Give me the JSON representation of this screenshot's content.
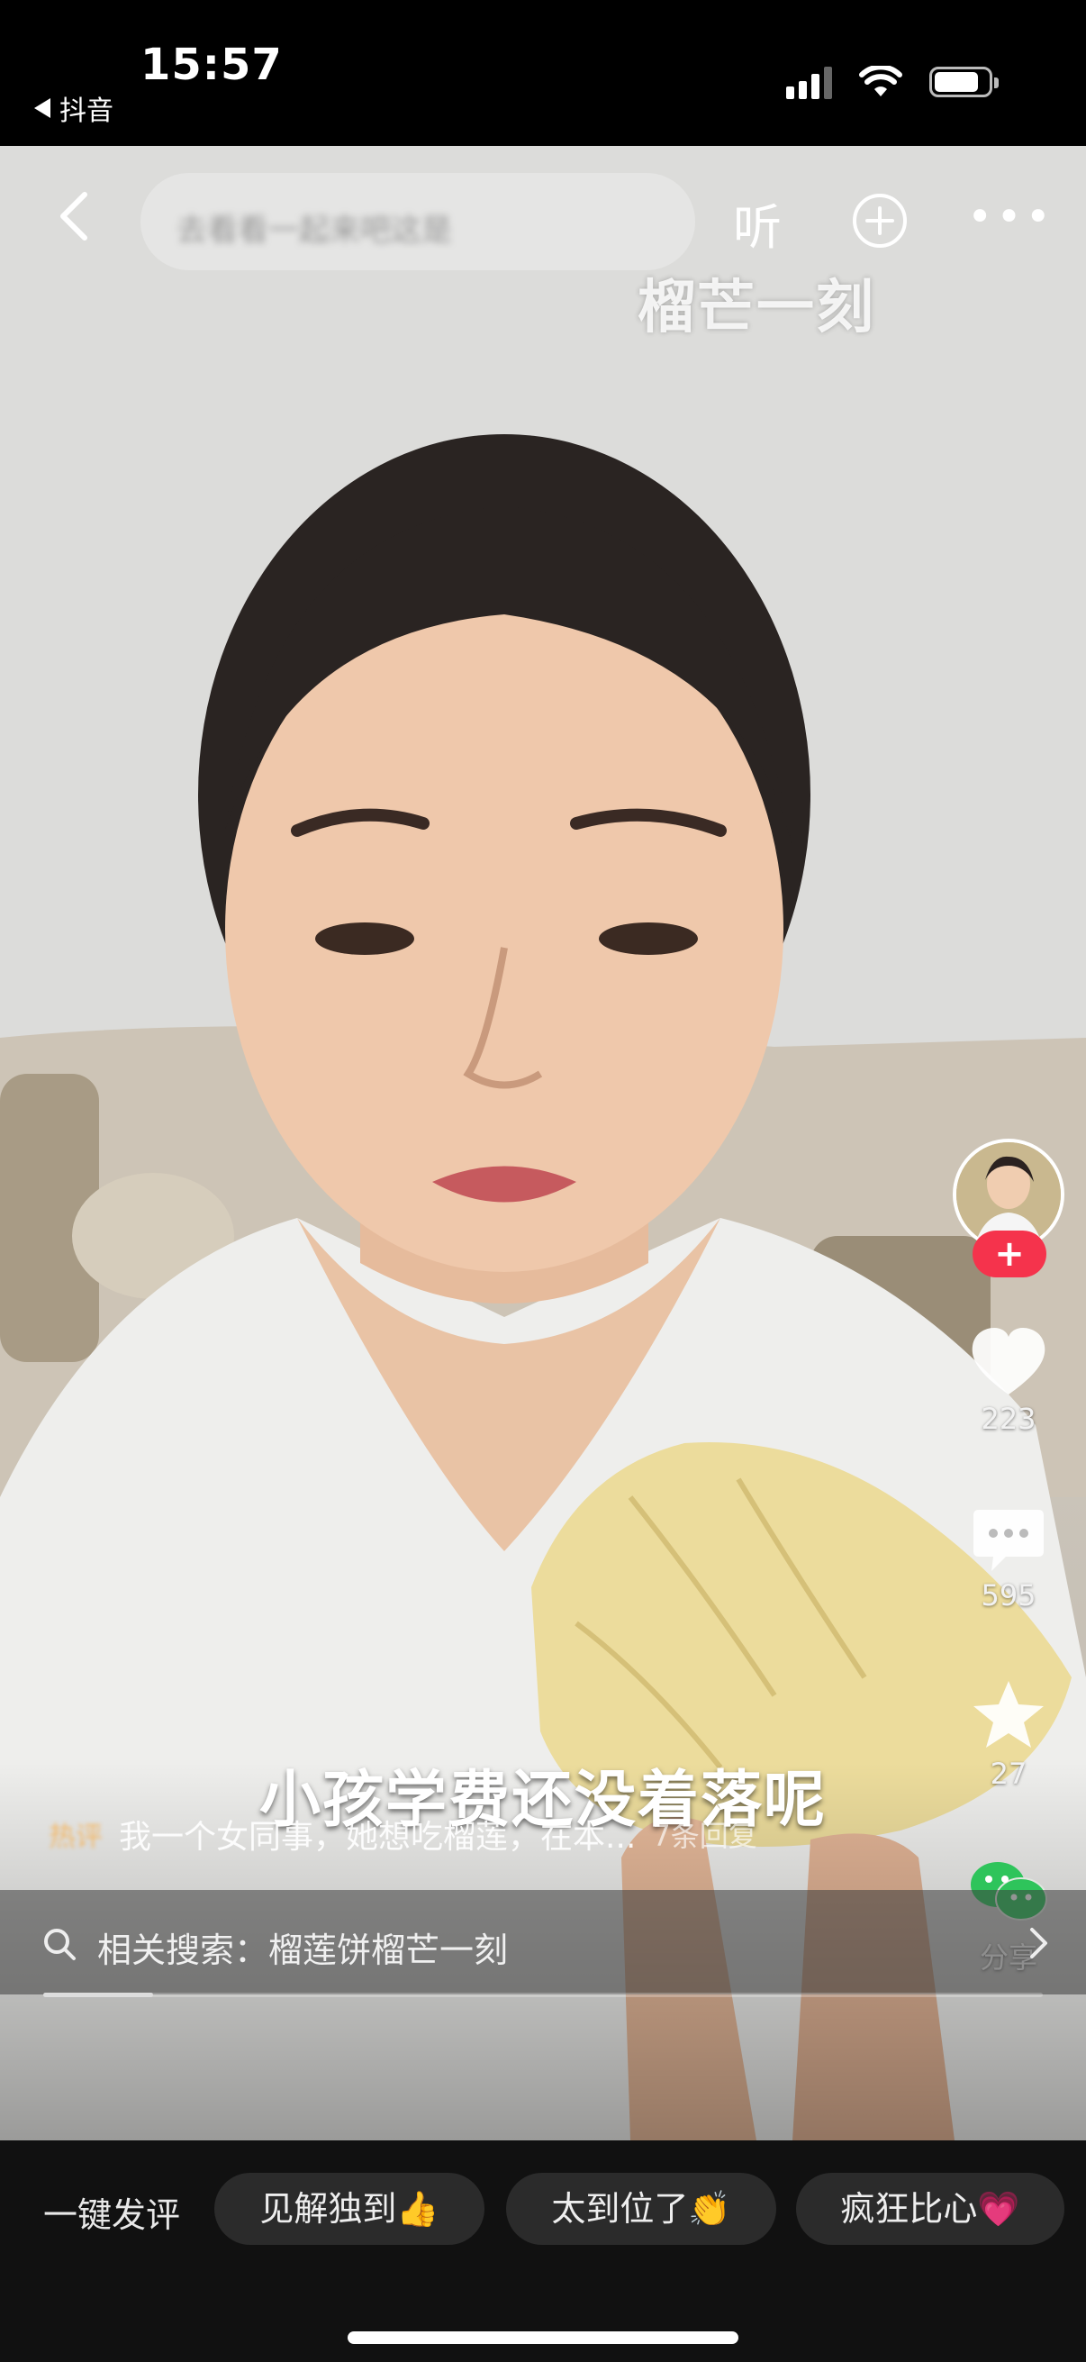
{
  "status_bar": {
    "time": "15:57",
    "back_app": "抖音",
    "battery_level": 0.85
  },
  "top_bar": {
    "search_placeholder": "去看看一起来吧这是",
    "listen_label": "听",
    "watermark": "榴芒一刻"
  },
  "right_rail": {
    "like_count": "223",
    "comment_count": "595",
    "favorite_count": "27",
    "share_label": "分享"
  },
  "video": {
    "subtitle": "小孩学费还没着落呢"
  },
  "comment_preview": {
    "tag": "热评",
    "text": "我一个女同事，她想吃榴莲，在本...",
    "replies": "7条回复"
  },
  "related_search": {
    "text": "相关搜索：榴莲饼榴芒一刻"
  },
  "playback": {
    "progress": 0.11
  },
  "quick_comment": {
    "label": "一键发评",
    "chips": [
      "见解独到👍",
      "太到位了👏",
      "疯狂比心💗"
    ]
  }
}
